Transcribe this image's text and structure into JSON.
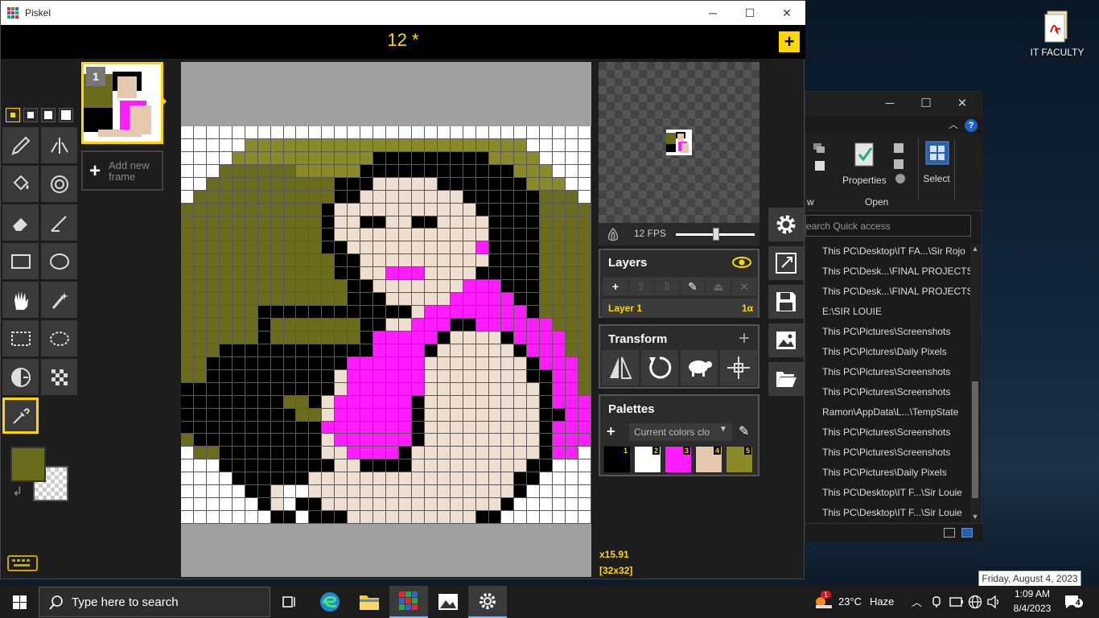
{
  "window": {
    "title": "Piskel",
    "minimize": "─",
    "maximize": "☐",
    "close": "✕"
  },
  "header": {
    "title": "12 *",
    "new_button": "+"
  },
  "frames": {
    "items": [
      {
        "number": "1"
      }
    ],
    "add_label_line1": "Add new",
    "add_label_line2": "frame"
  },
  "colors": {
    "primary": "#6b6b1c",
    "secondary": "transparent",
    "accent": "#ffd700"
  },
  "zoom": "x15.91",
  "canvas_size": "[32x32]",
  "fps": {
    "label": "12 FPS",
    "value": 12
  },
  "layers": {
    "title": "Layers",
    "items": [
      {
        "name": "Layer 1",
        "opacity": "1α"
      }
    ]
  },
  "transform": {
    "title": "Transform"
  },
  "palettes": {
    "title": "Palettes",
    "selected": "Current colors clo",
    "swatches": [
      {
        "num": "1",
        "color": "#000000"
      },
      {
        "num": "2",
        "color": "#ffffff"
      },
      {
        "num": "3",
        "color": "#ff1cff"
      },
      {
        "num": "4",
        "color": "#e6c8ae"
      },
      {
        "num": "5",
        "color": "#8a8a28"
      }
    ]
  },
  "sprite_rows": [
    "................................",
    "WWWWWWWWWWWWWWWWWWWWWWWWWWWWWWWW",
    "WWWWWOOOOOOOOOOOOOOOOOOOOOOWWWWW",
    "WWWWOOOOOOOOOOOKKKKKKKKKOOOOWWWW",
    "WWWDDDDDDOOOOOKKKKKKKKKKKKOOOWWW",
    "WWDDDDDDDDDDKKKSSSSSKKKKKKKOOOWW",
    "WDDDDDDDDDDDKKSSSSSSSSKKKKKKDDDW",
    "DDDDDDDDDDDKSSSSSSSSSSSKKKKKDDDD",
    "DDDDDDDDDDDKSSKKSSKKSSSSKKKKDDDD",
    "DDDDDDDDDDDKSSSSSSSSSSSSKKKKDDDD",
    "DDDDDDDDDDDKKSSSSSSSSSSPKKKKDDDD",
    "DDDDDDDDDDDDKKSSSSSSSSSSKKKKDDDD",
    "DDDDDDDDDDDDKKSSPPPSSSSKKKKKDDDD",
    "DDDDDDDDDDDDDKKSSSSSSSPPPKKKDDDD",
    "DDDDDDDDDDDDDKKKSSSSSPPPPPKKDDDD",
    "DDDDDDKKKKKKKKKKKKSPPPPPPPPKDDDD",
    "DDDDDDKDDDDDDDKKSSPPPKKPPPPPPDDD",
    "DDDDDDKDDDDDDDKPPPPPKSSSSKPPPPDD",
    "DDDKKKKKKKKKKKKPPPPKSSSSSSKPPPDD",
    "DDKKKKKKKKKKKPPPPPPSSSSSSSSKPPPD",
    "DDKKKKKKKKKKSPPPPPPSSSSSSSSKKPPD",
    "KKKKKKKKKKKKSPPPPPPSSSSSSSSSKPPD",
    "KKKKKKKKDDKSPPPPPPKSSSSSSSSSKPPP",
    "KKKKKKKKKDDSPPPPPPKSSSSSSSSSKKPP",
    "KKKKKKKKKKKPPPPPPPKSSSSSSSSSKPPP",
    "DKKKKKKKKKKSPPPPPPKSSSSSSSSSKPPP",
    "WDDKKKKKKKKSSPPPPKSSSSSSSSSSKPPW",
    "WWWKKKKKKKKKSSKKKKSSSSSSSSSKKWWW",
    "WWWWKKKKKKSSSSSSSSSSSSSSSSKKWWWW",
    "WWWWWKKSWWSSSSSSSSSSSSSSSSKWWWWW",
    "WWWWWWKSWKKSSSSSSSSSSSSSSKWWWWWW",
    "WWWWWWWKKWKKKSSSSSSSSSSKKWWWWWWW"
  ],
  "explorer": {
    "minimize": "─",
    "maximize": "☐",
    "close": "✕",
    "help": "?",
    "ribbon": {
      "properties": "Properties",
      "open": "Open",
      "select": "Select",
      "w": "w"
    },
    "search_placeholder": "earch Quick access",
    "items": [
      "This PC\\Desktop\\IT FA...\\Sir Rojo",
      "This PC\\Desk...\\FINAL PROJECTS",
      "This PC\\Desk...\\FINAL PROJECTS",
      "E:\\SIR LOUIE",
      "This PC\\Pictures\\Screenshots",
      "This PC\\Pictures\\Daily Pixels",
      "This PC\\Pictures\\Screenshots",
      "This PC\\Pictures\\Screenshots",
      "Ramon\\AppData\\L...\\TempState",
      "This PC\\Pictures\\Screenshots",
      "This PC\\Pictures\\Screenshots",
      "This PC\\Pictures\\Daily Pixels",
      "This PC\\Desktop\\IT F...\\Sir Louie",
      "This PC\\Desktop\\IT F...\\Sir Louie"
    ]
  },
  "desktop": {
    "icon_label": "IT FACULTY",
    "date_tooltip": "Friday, August 4, 2023"
  },
  "taskbar": {
    "search_placeholder": "Type here to search",
    "weather_temp": "23°C",
    "weather_desc": "Haze",
    "weather_badge": "1",
    "time": "1:09 AM",
    "date": "8/4/2023",
    "notifications": "4"
  }
}
